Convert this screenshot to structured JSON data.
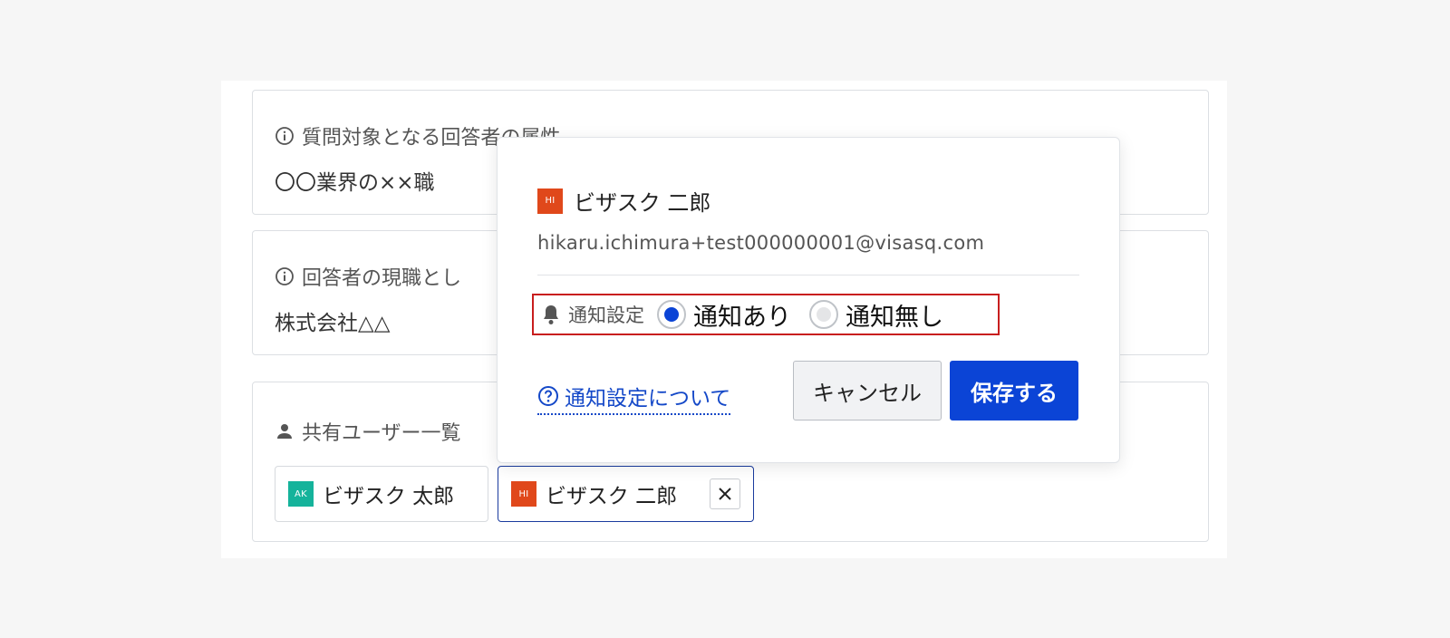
{
  "cards": [
    {
      "label": "質問対象となる回答者の属性",
      "value": "〇〇業界の××職"
    },
    {
      "label": "回答者の現職とし",
      "value": "株式会社△△"
    }
  ],
  "shared": {
    "label": "共有ユーザー一覧",
    "chips": [
      {
        "avatar": "AK",
        "avatar_color": "#15b39b",
        "name": "ビザスク 太郎"
      },
      {
        "avatar": "HI",
        "avatar_color": "#e0481b",
        "name": "ビザスク 二郎"
      }
    ]
  },
  "popover": {
    "avatar": "HI",
    "avatar_color": "#e0481b",
    "name": "ビザスク 二郎",
    "email": "hikaru.ichimura+test000000001@visasq.com",
    "notify_label": "通知設定",
    "options": [
      {
        "label": "通知あり",
        "selected": true
      },
      {
        "label": "通知無し",
        "selected": false
      }
    ],
    "help_link": "通知設定について",
    "cancel": "キャンセル",
    "save": "保存する"
  },
  "colors": {
    "accent": "#0b44d6",
    "link": "#1448c8",
    "highlight": "#c81e1e"
  }
}
